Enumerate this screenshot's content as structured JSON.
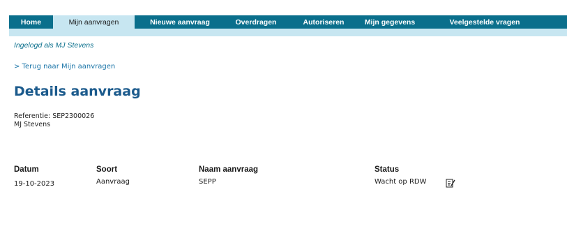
{
  "nav": {
    "items": [
      {
        "label": "Home",
        "active": false
      },
      {
        "label": "Mijn aanvragen",
        "active": true
      },
      {
        "label": "Nieuwe aanvraag",
        "active": false
      },
      {
        "label": "Overdragen",
        "active": false
      },
      {
        "label": "Autoriseren",
        "active": false
      },
      {
        "label": "Mijn gegevens",
        "active": false
      },
      {
        "label": "Veelgestelde vragen",
        "active": false
      }
    ]
  },
  "session": {
    "logged_in_text": "Ingelogd als MJ Stevens"
  },
  "back_link": "> Terug naar Mijn aanvragen",
  "page_title": "Details aanvraag",
  "reference": {
    "line1": "Referentie: SEP2300026",
    "line2": "MJ Stevens"
  },
  "table": {
    "headers": [
      "Datum",
      "Soort",
      "Naam aanvraag",
      "Status"
    ],
    "rows": [
      {
        "datum": "19-10-2023",
        "soort": "Aanvraag",
        "naam": "SEPP",
        "status": "Wacht op RDW",
        "action_icon": "edit-icon"
      }
    ]
  },
  "colors": {
    "nav_background": "#0a6f8c",
    "nav_active_background": "#c7e6f1",
    "title_color": "#1b5a8c",
    "link_color": "#1b75a8"
  }
}
